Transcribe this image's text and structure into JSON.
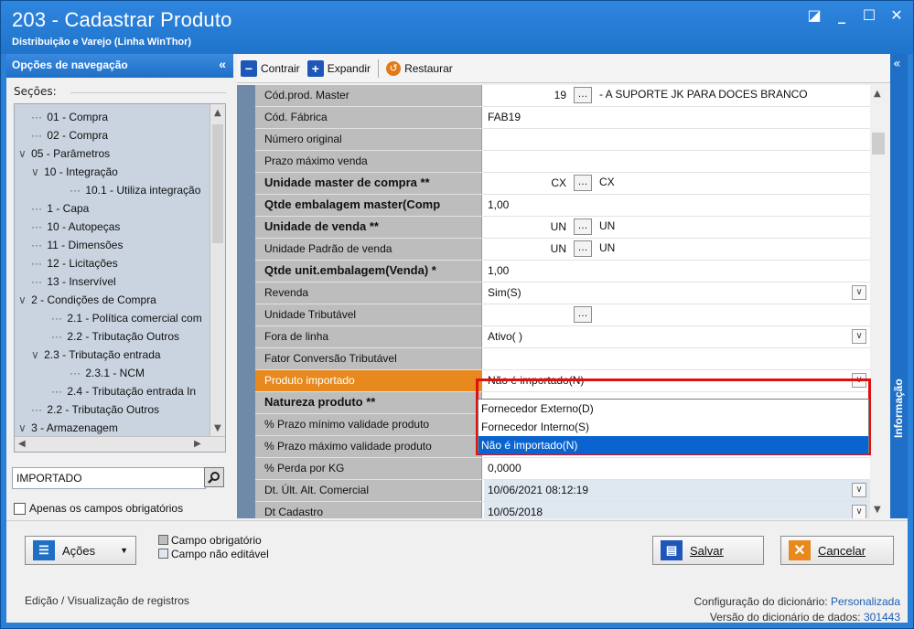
{
  "window": {
    "title": "203 - Cadastrar  Produto",
    "subtitle": "Distribuição e Varejo (Linha WinThor)"
  },
  "nav": {
    "header": "Opções de navegação",
    "sections_label": "Seções:",
    "tree": [
      {
        "label": "01 - Compra",
        "indent": 1,
        "prefix": "line"
      },
      {
        "label": "02 - Compra",
        "indent": 1,
        "prefix": "line"
      },
      {
        "label": "05 - Parâmetros",
        "indent": 0,
        "prefix": "chev"
      },
      {
        "label": "10 - Integração",
        "indent": 1,
        "prefix": "chev"
      },
      {
        "label": "10.1 - Utiliza integração",
        "indent": 3,
        "prefix": "line"
      },
      {
        "label": "1 - Capa",
        "indent": 1,
        "prefix": "line"
      },
      {
        "label": "10 - Autopeças",
        "indent": 1,
        "prefix": "line"
      },
      {
        "label": "11 - Dimensões",
        "indent": 1,
        "prefix": "line"
      },
      {
        "label": "12 - Licitações",
        "indent": 1,
        "prefix": "line"
      },
      {
        "label": "13 - Inservível",
        "indent": 1,
        "prefix": "line"
      },
      {
        "label": "2 - Condições de Compra",
        "indent": 0,
        "prefix": "chev"
      },
      {
        "label": "2.1 - Política comercial com",
        "indent": 2,
        "prefix": "line"
      },
      {
        "label": "2.2 - Tributação Outros",
        "indent": 2,
        "prefix": "line"
      },
      {
        "label": "2.3 - Tributação entrada",
        "indent": 1,
        "prefix": "chev"
      },
      {
        "label": "2.3.1 - NCM",
        "indent": 3,
        "prefix": "line"
      },
      {
        "label": "2.4 - Tributação entrada In",
        "indent": 2,
        "prefix": "line"
      },
      {
        "label": "2.2 - Tributação Outros",
        "indent": 1,
        "prefix": "line"
      },
      {
        "label": "3 - Armazenagem",
        "indent": 0,
        "prefix": "chev"
      }
    ],
    "search_value": "IMPORTADO",
    "only_required_label": "Apenas os campos obrigatórios"
  },
  "toolbar": {
    "contract": "Contrair",
    "expand": "Expandir",
    "restore": "Restaurar"
  },
  "fields": [
    {
      "label": "Cód.prod. Master",
      "value": "- A SUPORTE JK PARA DOCES BRANCO",
      "code": "19",
      "type": "lookup"
    },
    {
      "label": "Cód. Fábrica",
      "value": "FAB19",
      "type": "text"
    },
    {
      "label": "Número original",
      "value": "",
      "type": "text"
    },
    {
      "label": "Prazo máximo venda",
      "value": "",
      "type": "text"
    },
    {
      "label": "Unidade master de compra **",
      "value": "CX",
      "code": "CX",
      "type": "lookup",
      "bold": true
    },
    {
      "label": "Qtde embalagem master(Comp",
      "value": "1,00",
      "type": "text",
      "bold": true
    },
    {
      "label": "Unidade de venda **",
      "value": "UN",
      "code": "UN",
      "type": "lookup",
      "bold": true
    },
    {
      "label": "Unidade Padrão de venda",
      "value": "UN",
      "code": "UN",
      "type": "lookup"
    },
    {
      "label": "Qtde unit.embalagem(Venda) *",
      "value": "1,00",
      "type": "text",
      "bold": true
    },
    {
      "label": "Revenda",
      "value": "Sim(S)",
      "type": "select"
    },
    {
      "label": "Unidade Tributável",
      "value": "",
      "code": "",
      "type": "lookup"
    },
    {
      "label": "Fora de linha",
      "value": "Ativo( )",
      "type": "select"
    },
    {
      "label": "Fator Conversão Tributável",
      "value": "",
      "type": "text"
    },
    {
      "label": "Produto importado",
      "value": "Não é importado(N)",
      "type": "select",
      "highlight": true
    },
    {
      "label": "Natureza produto **",
      "value": "",
      "type": "text",
      "bold": true
    },
    {
      "label": "% Prazo mínimo validade produto",
      "value": "",
      "type": "text"
    },
    {
      "label": "% Prazo máximo validade produto",
      "value": "",
      "type": "text"
    },
    {
      "label": "% Perda por KG",
      "value": "0,0000",
      "type": "text"
    },
    {
      "label": "Dt. Últ. Alt. Comercial",
      "value": "10/06/2021 08:12:19",
      "type": "select",
      "readonly": true
    },
    {
      "label": "Dt Cadastro",
      "value": "10/05/2018",
      "type": "select",
      "readonly": true
    }
  ],
  "dropdown": {
    "options": [
      "Fornecedor Externo(D)",
      "Fornecedor Interno(S)",
      "Não é importado(N)"
    ],
    "selected_index": 2
  },
  "info_panel": "Informação",
  "actions_label": "Ações",
  "legend": {
    "required": "Campo obrigatório",
    "not_editable": "Campo não editável"
  },
  "save_label": "Salvar",
  "cancel_label": "Cancelar",
  "status": {
    "left": "Edição / Visualização de registros",
    "config_label": "Configuração do dicionário:",
    "config_value": "Personalizada",
    "version_label": "Versão do dicionário de dados:",
    "version_value": "301443"
  },
  "colors": {
    "titlebar": "#2a7fd6",
    "highlight_row": "#e8891e",
    "selected_option": "#0a64d0",
    "red_frame": "#e01010"
  }
}
